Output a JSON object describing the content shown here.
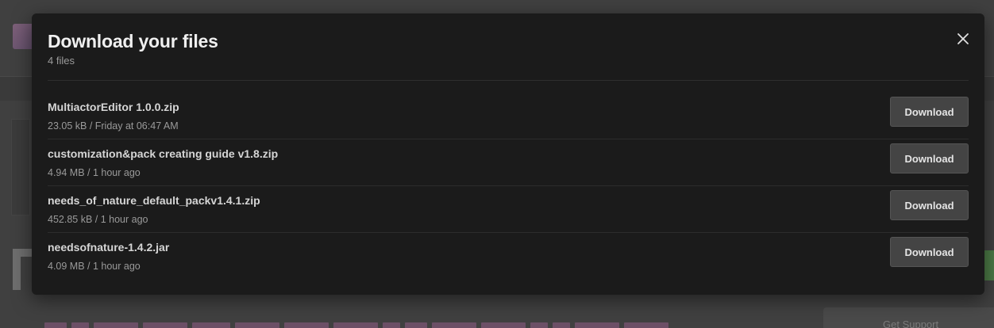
{
  "modal": {
    "title": "Download your files",
    "subtitle": "4 files",
    "close_icon": "close-icon"
  },
  "files": [
    {
      "name": "MultiactorEditor 1.0.0.zip",
      "size": "23.05 kB",
      "time": "Friday at 06:47 AM",
      "meta": "23.05 kB / Friday at 06:47 AM",
      "button_label": "Download"
    },
    {
      "name": "customization&pack creating guide v1.8.zip",
      "size": "4.94 MB",
      "time": "1 hour ago",
      "meta": "4.94 MB / 1 hour ago",
      "button_label": "Download"
    },
    {
      "name": "needs_of_nature_default_packv1.4.1.zip",
      "size": "452.85 kB",
      "time": "1 hour ago",
      "meta": "452.85 kB / 1 hour ago",
      "button_label": "Download"
    },
    {
      "name": "needsofnature-1.4.2.jar",
      "size": "4.09 MB",
      "time": "1 hour ago",
      "meta": "4.09 MB / 1 hour ago",
      "button_label": "Download"
    }
  ],
  "background": {
    "support_label": "Get Support"
  },
  "colors": {
    "overlay": "#404040",
    "modal_bg": "#1b1b1b",
    "button_bg": "#444444",
    "title_text": "#f0f0f0",
    "muted_text": "#9b9b9b"
  }
}
